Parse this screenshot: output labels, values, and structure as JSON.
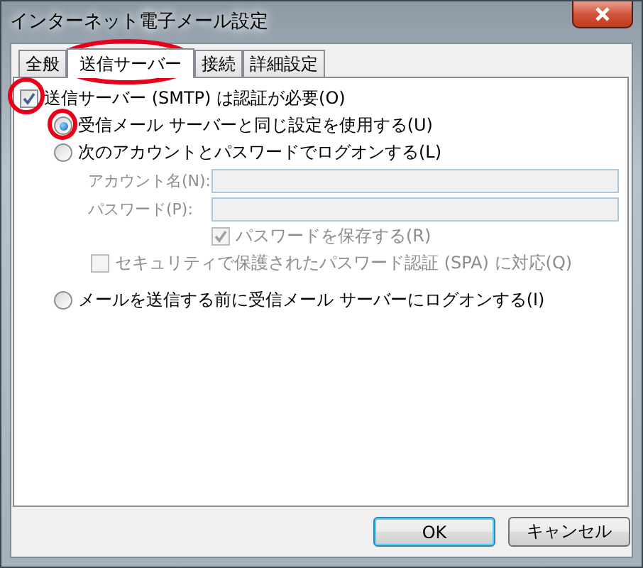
{
  "window": {
    "title": "インターネット電子メール設定"
  },
  "tabs": [
    {
      "label": "全般",
      "selected": false
    },
    {
      "label": "送信サーバー",
      "selected": true
    },
    {
      "label": "接続",
      "selected": false
    },
    {
      "label": "詳細設定",
      "selected": false
    }
  ],
  "auth_required": {
    "label": "送信サーバー (SMTP) は認証が必要(O)",
    "checked": true
  },
  "logon_options": [
    {
      "label": "受信メール サーバーと同じ設定を使用する(U)",
      "selected": true
    },
    {
      "label": "次のアカウントとパスワードでログオンする(L)",
      "selected": false
    }
  ],
  "account_fields": [
    {
      "label": "アカウント名(N):",
      "disabled": true
    },
    {
      "label": "パスワード(P):",
      "disabled": true
    }
  ],
  "save_password": {
    "label": "パスワードを保存する(R)",
    "checked": true,
    "disabled": true
  },
  "spa": {
    "label": "セキュリティで保護されたパスワード認証 (SPA) に対応(Q)",
    "checked": false,
    "disabled": true
  },
  "logon_before_send": {
    "label": "メールを送信する前に受信メール サーバーにログオンする(I)",
    "selected": false
  },
  "buttons": [
    {
      "label": "OK",
      "kind": "default"
    },
    {
      "label": "キャンセル",
      "kind": "normal"
    }
  ]
}
